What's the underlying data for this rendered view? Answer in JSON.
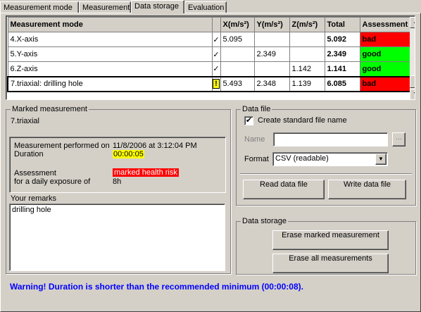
{
  "tabs": [
    "Measurement mode",
    "Measurement",
    "Data storage",
    "Evaluation"
  ],
  "grid": {
    "headers": [
      "Measurement mode",
      "",
      "X(m/s²)",
      "Y(m/s²)",
      "Z(m/s²)",
      "Total",
      "Assessment"
    ],
    "rows": [
      {
        "mode": "4.X-axis",
        "flag": "✓",
        "x": "5.095",
        "y": "",
        "z": "",
        "total": "5.092",
        "assessment": "bad",
        "color": "#ff0000"
      },
      {
        "mode": "5.Y-axis",
        "flag": "✓",
        "x": "",
        "y": "2.349",
        "z": "",
        "total": "2.349",
        "assessment": "good",
        "color": "#00ff00"
      },
      {
        "mode": "6.Z-axis",
        "flag": "✓",
        "x": "",
        "y": "",
        "z": "1.142",
        "total": "1.141",
        "assessment": "good",
        "color": "#00ff00"
      },
      {
        "mode": "7.triaxial: drilling hole",
        "flag": "!",
        "x": "5.493",
        "y": "2.348",
        "z": "1.139",
        "total": "6.085",
        "assessment": "bad",
        "color": "#ff0000"
      }
    ]
  },
  "marked": {
    "title": "Marked measurement",
    "mode": "7.triaxial",
    "performed_label": "Measurement performed on",
    "performed_value": "11/8/2006 at 3:12:04 PM",
    "duration_label": "Duration",
    "duration_value": "00:00:05",
    "assessment_label": "Assessment",
    "assessment_value": "marked health risk",
    "exposure_label": "for a daily exposure of",
    "exposure_value": "8h",
    "remarks_label": "Your remarks",
    "remarks_value": "drilling hole"
  },
  "datafile": {
    "title": "Data file",
    "standard_name_label": "Create standard file name",
    "standard_name_checked": "✔",
    "name_label": "Name",
    "name_value": "",
    "browse_label": "...",
    "format_label": "Format",
    "format_value": "CSV (readable)",
    "read_label": "Read data file",
    "write_label": "Write data file"
  },
  "storage": {
    "title": "Data storage",
    "erase_marked_label": "Erase marked measurement",
    "erase_all_label": "Erase all measurements"
  },
  "warning": "Warning!  Duration is shorter than the recommended minimum (00:00:08).",
  "colors": {
    "duration_highlight": "#ffff00",
    "risk_highlight": "#ff0000",
    "warning_text": "#0000ff"
  }
}
